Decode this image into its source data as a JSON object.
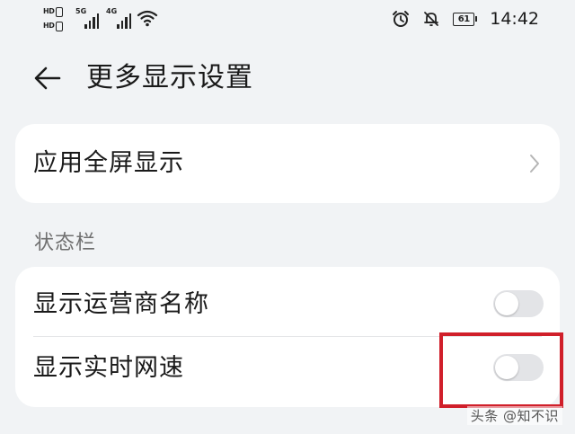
{
  "status_bar": {
    "sim1_label": "HD",
    "sim2_label": "HD",
    "network1_label": "5G",
    "network2_label": "4G",
    "battery_level": "61",
    "time": "14:42"
  },
  "header": {
    "title": "更多显示设置"
  },
  "fullscreen_card": {
    "label": "应用全屏显示"
  },
  "status_bar_section": {
    "title": "状态栏",
    "items": [
      {
        "label": "显示运营商名称",
        "enabled": false
      },
      {
        "label": "显示实时网速",
        "enabled": false
      }
    ]
  },
  "annotation": {
    "highlight_color": "#d01f2a"
  },
  "watermark": {
    "text": "头条 @知不识"
  },
  "colors": {
    "background": "#f1f3f5",
    "card": "#ffffff",
    "toggle_off": "#e3e4e7",
    "secondary_text": "#6f6f6f"
  }
}
